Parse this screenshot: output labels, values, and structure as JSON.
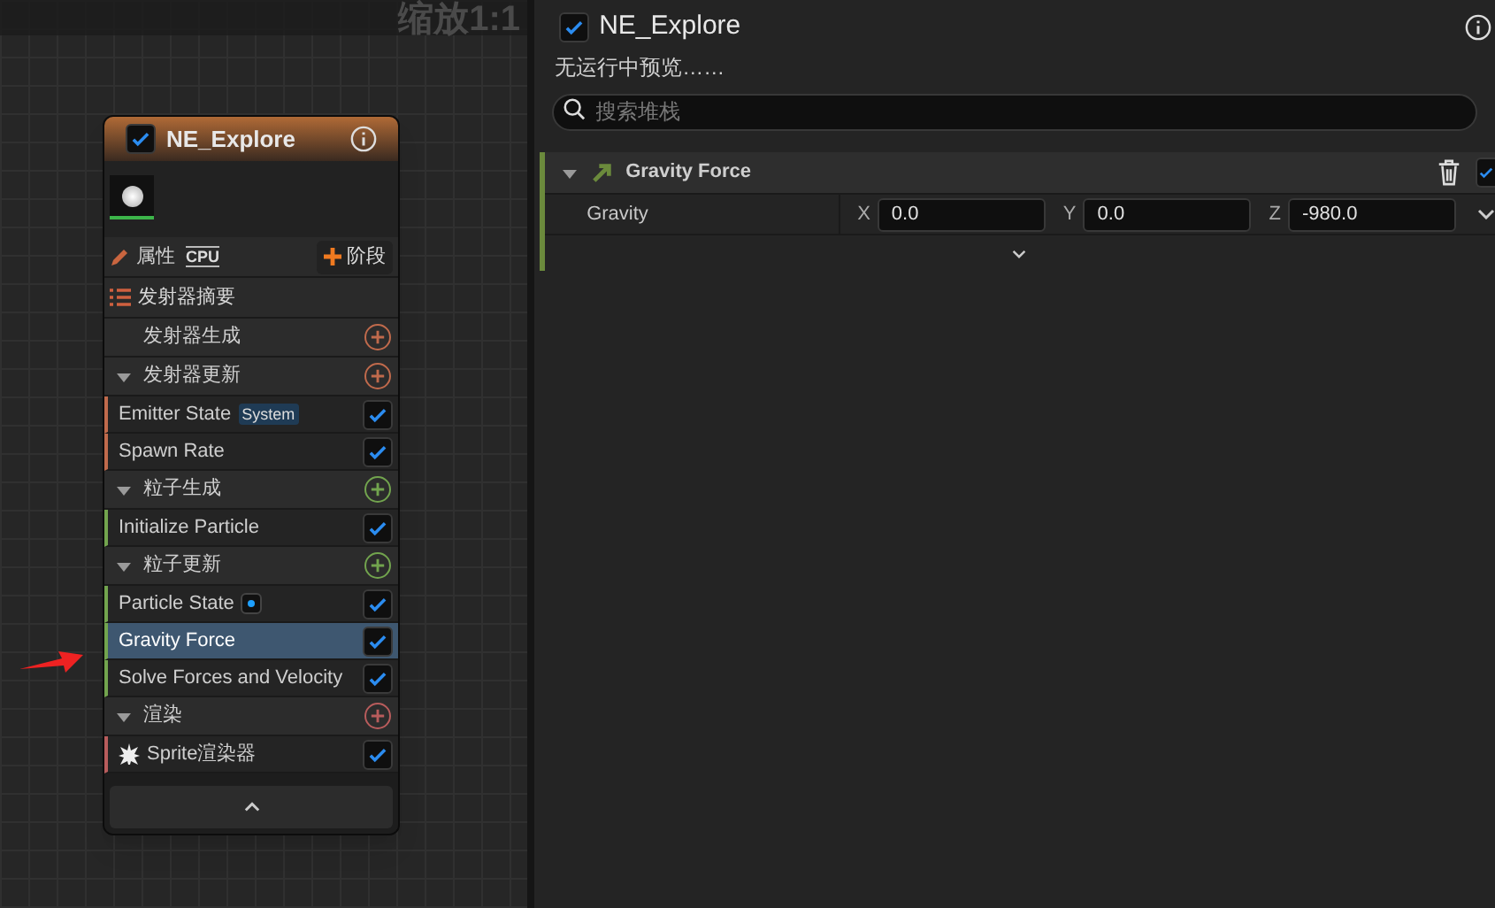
{
  "graph": {
    "zoom_label": "缩放1:1",
    "node": {
      "title": "NE_Explore",
      "enabled": true,
      "properties_label": "属性",
      "cpu_label": "CPU",
      "stage_button": "阶段",
      "summary": "发射器摘要",
      "groups": [
        {
          "label": "发射器生成",
          "color": "#c06a4c"
        },
        {
          "label": "发射器更新",
          "color": "#c06a4c",
          "modules": [
            {
              "label": "Emitter State",
              "badge": "System",
              "checked": true,
              "selected": false
            },
            {
              "label": "Spawn Rate",
              "checked": true,
              "selected": false
            }
          ]
        },
        {
          "label": "粒子生成",
          "color": "#72a44e",
          "modules": [
            {
              "label": "Initialize Particle",
              "checked": true,
              "selected": false
            }
          ]
        },
        {
          "label": "粒子更新",
          "color": "#72a44e",
          "modules": [
            {
              "label": "Particle State",
              "dot": true,
              "checked": true,
              "selected": false
            },
            {
              "label": "Gravity Force",
              "checked": true,
              "selected": true
            },
            {
              "label": "Solve Forces and Velocity",
              "checked": true,
              "selected": false
            }
          ]
        },
        {
          "label": "渲染",
          "color": "#b85c5c",
          "modules": [
            {
              "label": "Sprite渲染器",
              "kind": "sprite",
              "checked": true,
              "selected": false
            }
          ]
        }
      ]
    }
  },
  "details": {
    "enabled": true,
    "title": "NE_Explore",
    "status": "无运行中预览……",
    "search": {
      "placeholder": "搜索堆栈"
    },
    "module": {
      "title": "Gravity Force",
      "checked": true,
      "params": [
        {
          "label": "Gravity",
          "components": [
            {
              "axis": "X",
              "value": "0.0"
            },
            {
              "axis": "Y",
              "value": "0.0"
            },
            {
              "axis": "Z",
              "value": "-980.0"
            }
          ]
        }
      ]
    }
  }
}
